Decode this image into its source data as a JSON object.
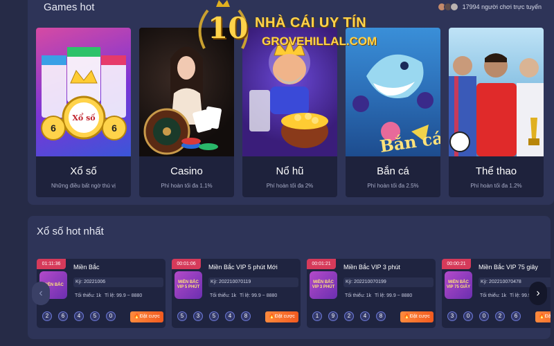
{
  "watermark": {
    "number": "10",
    "line1": "NHÀ CÁI UY TÍN",
    "line2": "GROVEHILLAL.COM"
  },
  "games_section": {
    "title": "Games hot",
    "online_text": "17994 người chơi trực tuyến",
    "cards": [
      {
        "title": "Xổ số",
        "subtitle": "Những điều bất ngờ thú vị"
      },
      {
        "title": "Casino",
        "subtitle": "Phí hoàn tối đa 1.1%"
      },
      {
        "title": "Nổ hũ",
        "subtitle": "Phí hoàn tối đa 2%"
      },
      {
        "title": "Bắn cá",
        "subtitle": "Phí hoàn tối đa 2.5%"
      },
      {
        "title": "Thể thao",
        "subtitle": "Phí hoàn tối đa 1.2%"
      }
    ]
  },
  "lottery_section": {
    "title": "Xổ số hot nhất",
    "bet_label": "Đặt cược",
    "items": [
      {
        "timer": "01:11:36",
        "badge": "MIỀN BẮC",
        "name": "Miền Bắc",
        "ky": "Kỳ: 20221006",
        "min": "Tối thiểu: 1k",
        "rate": "Tỉ lệ: 99.9 ~ 8880",
        "balls": [
          "2",
          "6",
          "4",
          "5",
          "0"
        ]
      },
      {
        "timer": "00:01:06",
        "badge": "MIỀN BẮC VIP 5 PHÚT",
        "name": "Miền Bắc VIP 5 phút Mới",
        "ky": "Kỳ: 202210070119",
        "min": "Tối thiểu: 1k",
        "rate": "Tỉ lệ: 99.9 ~ 8880",
        "balls": [
          "5",
          "3",
          "5",
          "4",
          "8"
        ]
      },
      {
        "timer": "00:01:21",
        "badge": "MIỀN BẮC VIP 3 PHÚT",
        "name": "Miền Bắc VIP 3 phút",
        "ky": "Kỳ: 202210070199",
        "min": "Tối thiểu: 1k",
        "rate": "Tỉ lệ: 99.9 ~ 8880",
        "balls": [
          "1",
          "9",
          "2",
          "4",
          "8"
        ]
      },
      {
        "timer": "00:00:21",
        "badge": "MIỀN BẮC VIP 75 GIÂY",
        "name": "Miền Bắc VIP 75 giây",
        "ky": "Kỳ: 202210070478",
        "min": "Tối thiểu: 1k",
        "rate": "Tỉ lệ: 99.9",
        "balls": [
          "3",
          "0",
          "0",
          "2",
          "6"
        ]
      }
    ]
  }
}
